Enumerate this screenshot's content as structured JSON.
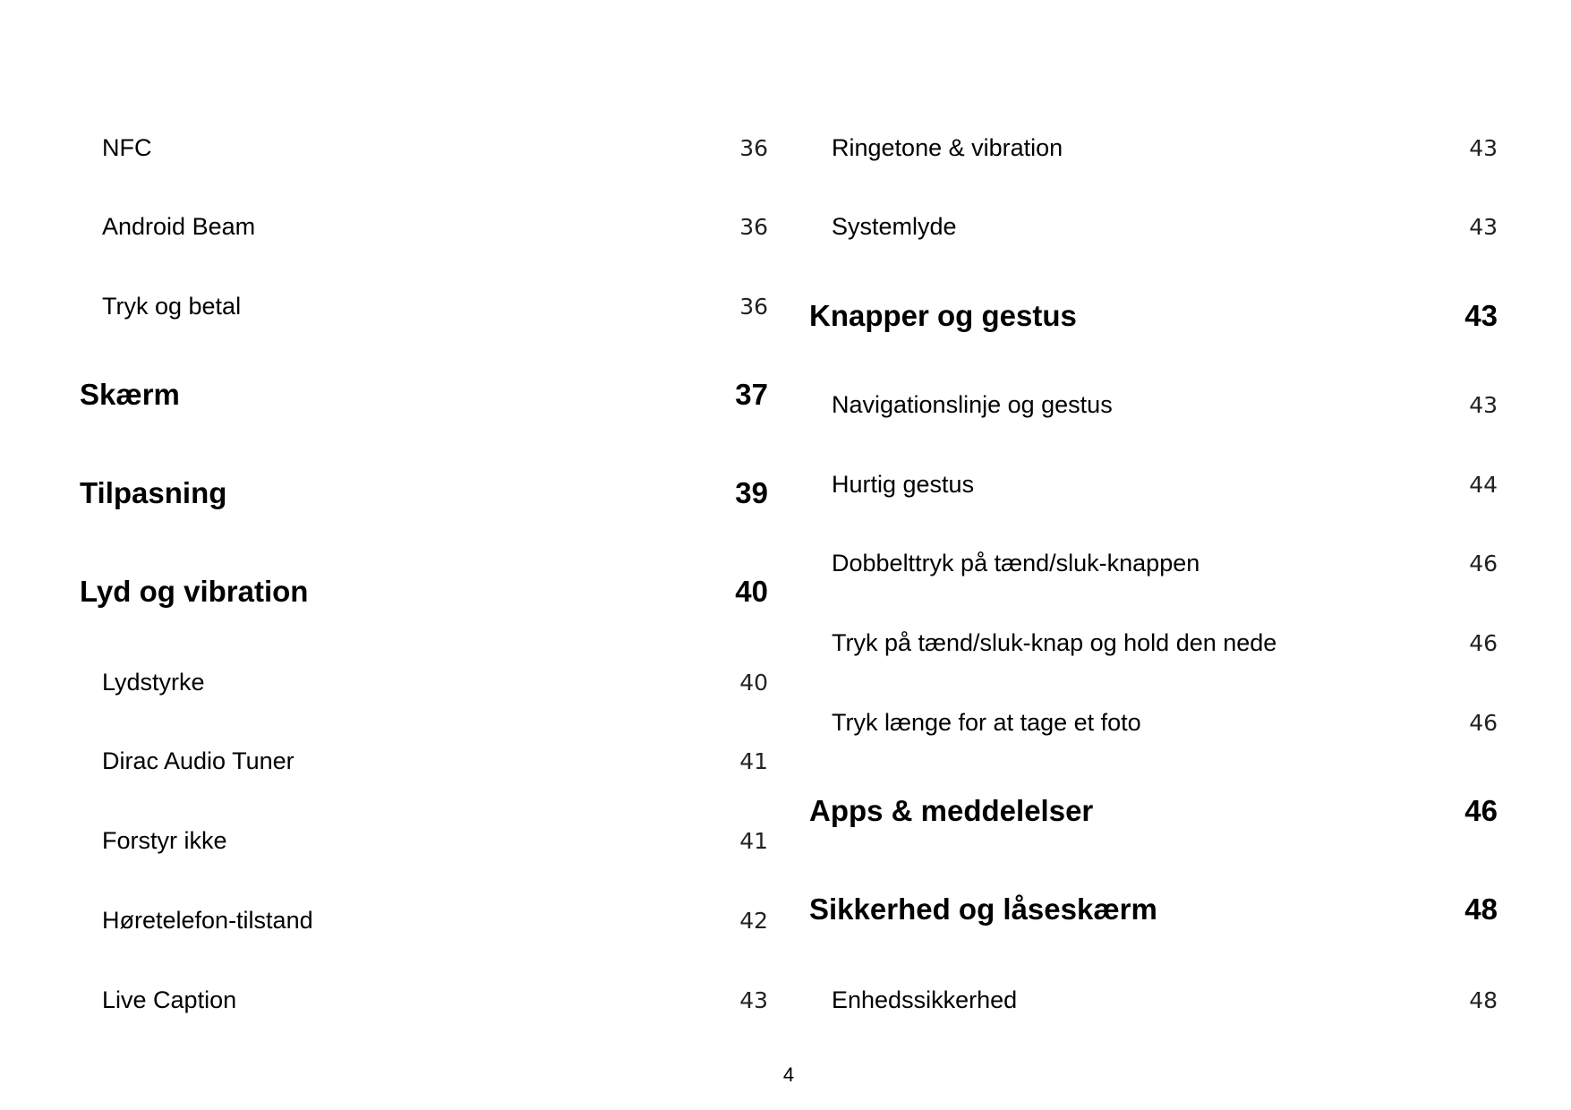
{
  "left_column": [
    {
      "type": "sub",
      "label": "NFC",
      "page": "36"
    },
    {
      "type": "sub",
      "label": "Android Beam",
      "page": "36"
    },
    {
      "type": "sub",
      "label": "Tryk og betal",
      "page": "36"
    },
    {
      "type": "head",
      "label": "Skærm",
      "page": "37"
    },
    {
      "type": "head",
      "label": "Tilpasning",
      "page": "39"
    },
    {
      "type": "head",
      "label": "Lyd og vibration",
      "page": "40"
    },
    {
      "type": "sub",
      "label": "Lydstyrke",
      "page": "40"
    },
    {
      "type": "sub",
      "label": "Dirac Audio Tuner",
      "page": "41"
    },
    {
      "type": "sub",
      "label": "Forstyr ikke",
      "page": "41"
    },
    {
      "type": "sub",
      "label": "Høretelefon-tilstand",
      "page": "42"
    },
    {
      "type": "sub",
      "label": "Live Caption",
      "page": "43"
    }
  ],
  "right_column": [
    {
      "type": "sub",
      "label": "Ringetone & vibration",
      "page": "43"
    },
    {
      "type": "sub",
      "label": "Systemlyde",
      "page": "43"
    },
    {
      "type": "head",
      "label": "Knapper og gestus",
      "page": "43"
    },
    {
      "type": "sub",
      "label": "Navigationslinje og gestus",
      "page": "43"
    },
    {
      "type": "sub",
      "label": "Hurtig gestus",
      "page": "44"
    },
    {
      "type": "sub",
      "label": "Dobbelttryk på tænd/sluk-knappen",
      "page": "46"
    },
    {
      "type": "sub",
      "label": "Tryk på tænd/sluk-knap og hold den nede",
      "page": "46"
    },
    {
      "type": "sub",
      "label": "Tryk længe for at tage et foto",
      "page": "46"
    },
    {
      "type": "head",
      "label": "Apps & meddelelser",
      "page": "46"
    },
    {
      "type": "head",
      "label": "Sikkerhed og låseskærm",
      "page": "48"
    },
    {
      "type": "sub",
      "label": "Enhedssikkerhed",
      "page": "48"
    }
  ],
  "page_number": "4"
}
